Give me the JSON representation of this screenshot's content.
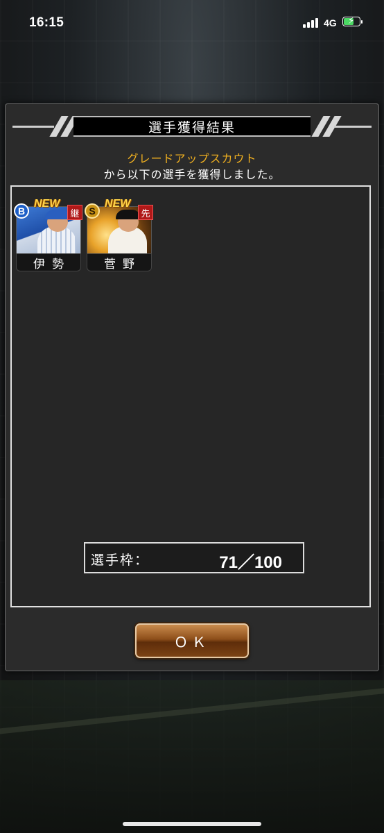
{
  "status_bar": {
    "time": "16:15",
    "network": "4G",
    "icons": [
      "signal-icon",
      "battery-charging-icon"
    ]
  },
  "dialog": {
    "title": "選手獲得結果",
    "scout_name": "グレードアップスカウト",
    "message": "から以下の選手を獲得しました。",
    "players": [
      {
        "name": "伊勢",
        "grade": "B",
        "badge": "NEW",
        "position": "継",
        "theme_color": "#1d5fc8"
      },
      {
        "name": "菅野",
        "grade": "S",
        "badge": "NEW",
        "position": "先",
        "theme_color": "#c99417"
      }
    ],
    "slots_label": "選手枠：",
    "slots_value": "71／100",
    "ok_label": "ＯＫ"
  },
  "colors": {
    "scout_text": "#f0b020",
    "position_badge": "#b01818",
    "ok_button": "#8e4f1a"
  }
}
